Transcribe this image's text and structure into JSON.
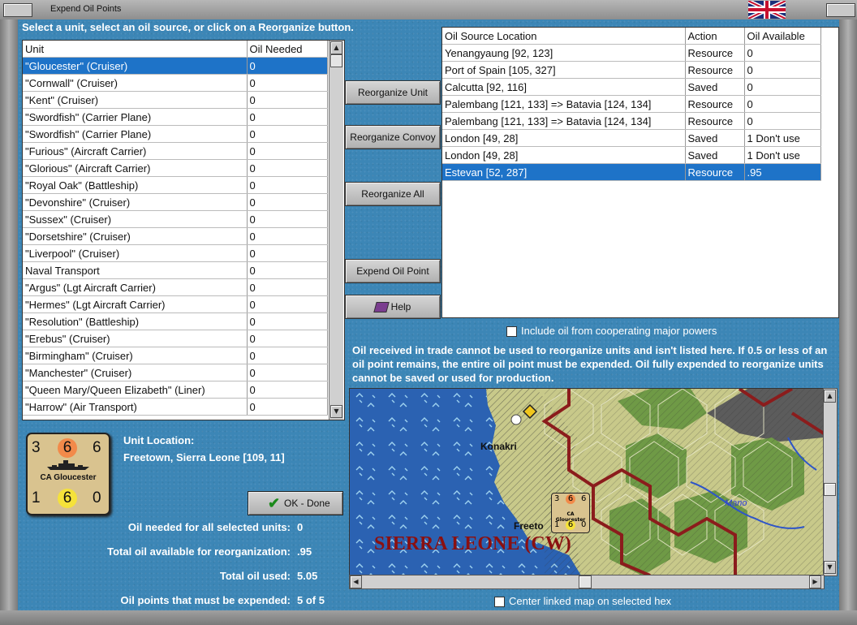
{
  "window": {
    "title": "Expend Oil Points"
  },
  "instruction": "Select a unit, select an oil source, or click on a Reorganize button.",
  "units_table": {
    "headers": [
      "Unit",
      "Oil Needed"
    ],
    "rows": [
      [
        "\"Gloucester\" (Cruiser)",
        "0"
      ],
      [
        "\"Cornwall\" (Cruiser)",
        "0"
      ],
      [
        "\"Kent\" (Cruiser)",
        "0"
      ],
      [
        "\"Swordfish\" (Carrier Plane)",
        "0"
      ],
      [
        "\"Swordfish\" (Carrier Plane)",
        "0"
      ],
      [
        "\"Furious\" (Aircraft Carrier)",
        "0"
      ],
      [
        "\"Glorious\" (Aircraft Carrier)",
        "0"
      ],
      [
        "\"Royal Oak\" (Battleship)",
        "0"
      ],
      [
        "\"Devonshire\" (Cruiser)",
        "0"
      ],
      [
        "\"Sussex\" (Cruiser)",
        "0"
      ],
      [
        "\"Dorsetshire\" (Cruiser)",
        "0"
      ],
      [
        "\"Liverpool\" (Cruiser)",
        "0"
      ],
      [
        "Naval Transport",
        "0"
      ],
      [
        "\"Argus\" (Lgt Aircraft Carrier)",
        "0"
      ],
      [
        "\"Hermes\" (Lgt Aircraft Carrier)",
        "0"
      ],
      [
        "\"Resolution\" (Battleship)",
        "0"
      ],
      [
        "\"Erebus\" (Cruiser)",
        "0"
      ],
      [
        "\"Birmingham\" (Cruiser)",
        "0"
      ],
      [
        "\"Manchester\" (Cruiser)",
        "0"
      ],
      [
        "\"Queen Mary/Queen Elizabeth\" (Liner)",
        "0"
      ],
      [
        "\"Harrow\" (Air Transport)",
        "0"
      ]
    ],
    "selected_index": 0
  },
  "oil_table": {
    "headers": [
      "Oil Source Location",
      "Action",
      "Oil Available"
    ],
    "rows": [
      [
        "Yenangyaung [92, 123]",
        "Resource",
        "0"
      ],
      [
        "Port of Spain [105, 327]",
        "Resource",
        "0"
      ],
      [
        "Calcutta [92, 116]",
        "Saved",
        "0"
      ],
      [
        "Palembang [121, 133] => Batavia [124, 134]",
        "Resource",
        "0"
      ],
      [
        "Palembang [121, 133] => Batavia [124, 134]",
        "Resource",
        "0"
      ],
      [
        "London [49, 28]",
        "Saved",
        "1 Don't use"
      ],
      [
        "London [49, 28]",
        "Saved",
        "1 Don't use"
      ],
      [
        "Estevan [52, 287]",
        "Resource",
        ".95"
      ]
    ],
    "selected_index": 7
  },
  "buttons": {
    "reorganize_unit": "Reorganize Unit",
    "reorganize_convoy": "Reorganize Convoy",
    "reorganize_all": "Reorganize All",
    "expend_oil_point": "Expend Oil Point",
    "help": "Help",
    "ok_done": "OK - Done"
  },
  "unit_counter": {
    "top_left": "3",
    "top_mid": "6",
    "top_right": "6",
    "name": "CA Gloucester",
    "bottom_left": "1",
    "bottom_mid": "6",
    "bottom_right": "0"
  },
  "unit_location": {
    "label": "Unit Location:",
    "value": "Freetown, Sierra Leone [109, 11]"
  },
  "summary": {
    "oil_needed_label": "Oil needed for all selected units:",
    "oil_needed_value": "0",
    "total_available_label": "Total oil available for reorganization:",
    "total_available_value": ".95",
    "total_used_label": "Total oil used:",
    "total_used_value": "5.05",
    "must_expend_label": "Oil points that must be expended:",
    "must_expend_value": "5 of 5"
  },
  "checkboxes": {
    "include_cooperating": {
      "label": "Include oil from cooperating major powers",
      "checked": false
    },
    "center_map": {
      "label": "Center linked map on selected hex",
      "checked": false
    }
  },
  "note": "Oil received in trade cannot be used to reorganize units and isn't listed here.  If 0.5 or less of an oil point remains, the entire oil point must be expended.   Oil fully expended to reorganize units cannot be saved or used for production.",
  "map": {
    "labels": {
      "city1": "Konakri",
      "city2": "Freeto",
      "river": "Mano",
      "region": "SIERRA LEONE (CW)"
    },
    "mini_counter": {
      "top_left": "3",
      "top_mid": "6",
      "top_right": "6",
      "name": "CA Gloucester",
      "bottom_left": "1",
      "bottom_mid": "6",
      "bottom_right": "0"
    }
  },
  "colors": {
    "selection": "#1e73c8",
    "panel": "#3c86b6",
    "counter_bg": "#d9c38f",
    "attack_circle": "#f28a4a",
    "move_circle": "#f5e23a",
    "region_label": "#8b1010",
    "border_red": "#8b1c1c"
  }
}
